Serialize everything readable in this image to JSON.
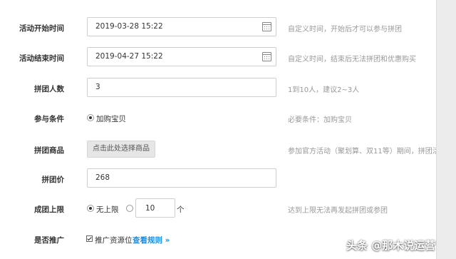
{
  "form": {
    "start_time": {
      "label": "活动开始时间",
      "value": "2019-03-28 15:22",
      "hint": "自定义时间，开始后才可以参与拼团"
    },
    "end_time": {
      "label": "活动结束时间",
      "value": "2019-04-27 15:22",
      "hint": "自定义时间，结束后无法拼团和优惠购买"
    },
    "group_size": {
      "label": "拼团人数",
      "value": "3",
      "hint": "1到10人，建议2~3人"
    },
    "condition": {
      "label": "参与条件",
      "option": "加购宝贝",
      "hint": "必要条件：加购宝贝"
    },
    "goods": {
      "label": "拼团商品",
      "button": "点击此处选择商品",
      "hint": "参加官方活动（聚划算、双11等）期间，拼团活"
    },
    "price": {
      "label": "拼团价",
      "value": "268"
    },
    "limit": {
      "label": "成团上限",
      "option_unlimited": "无上限",
      "limit_value": "10",
      "unit": "个",
      "hint": "达到上限无法再发起拼团或参团"
    },
    "promote": {
      "label": "是否推广",
      "checkbox_label": "推广资源位",
      "link": "查看规则 »"
    }
  },
  "watermark": "头条 @那木说运营"
}
